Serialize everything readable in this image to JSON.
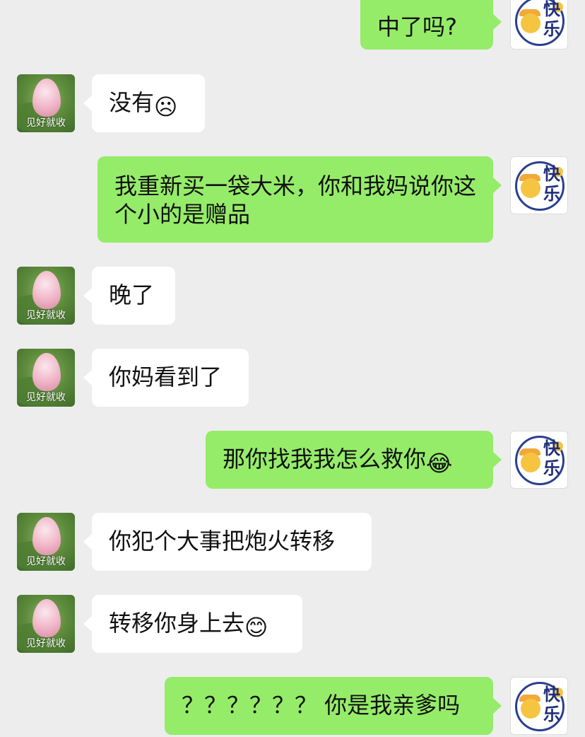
{
  "contact": {
    "avatar_caption": "见好就收"
  },
  "self": {
    "avatar_text": "快乐"
  },
  "messages": [
    {
      "side": "out",
      "text": "中了吗?",
      "emoji": ""
    },
    {
      "side": "in",
      "text": "没有",
      "emoji": "☹"
    },
    {
      "side": "out",
      "text": "我重新买一袋大米，你和我妈说你这个小的是赠品",
      "emoji": ""
    },
    {
      "side": "in",
      "text": "晚了",
      "emoji": ""
    },
    {
      "side": "in",
      "text": "你妈看到了",
      "emoji": ""
    },
    {
      "side": "out",
      "text": "那你找我我怎么救你",
      "emoji": "😂"
    },
    {
      "side": "in",
      "text": "你犯个大事把炮火转移",
      "emoji": ""
    },
    {
      "side": "in",
      "text": "转移你身上去",
      "emoji": "😊"
    },
    {
      "side": "out",
      "text": "？？？？？？ 你是我亲爹吗",
      "emoji": ""
    }
  ]
}
